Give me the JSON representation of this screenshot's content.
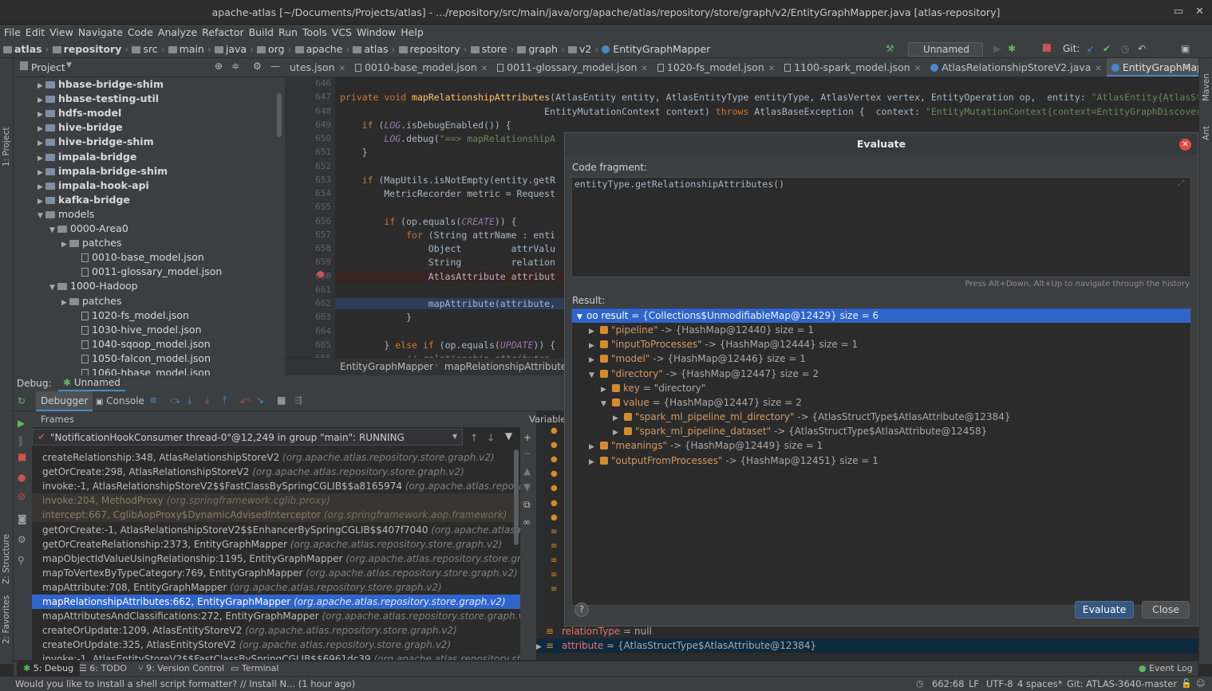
{
  "window": {
    "title": "apache-atlas [~/Documents/Projects/atlas] - .../repository/src/main/java/org/apache/atlas/repository/store/graph/v2/EntityGraphMapper.java [atlas-repository]"
  },
  "menu": [
    "File",
    "Edit",
    "View",
    "Navigate",
    "Code",
    "Analyze",
    "Refactor",
    "Build",
    "Run",
    "Tools",
    "VCS",
    "Window",
    "Help"
  ],
  "breadcrumbs": [
    "atlas",
    "repository",
    "src",
    "main",
    "java",
    "org",
    "apache",
    "atlas",
    "repository",
    "store",
    "graph",
    "v2",
    "EntityGraphMapper"
  ],
  "toolbar": {
    "run_config": "Unnamed",
    "git_label": "Git:"
  },
  "project_panel": {
    "title": "Project",
    "items": [
      {
        "label": "hbase-bridge-shim",
        "bold": true
      },
      {
        "label": "hbase-testing-util",
        "bold": true
      },
      {
        "label": "hdfs-model",
        "bold": true
      },
      {
        "label": "hive-bridge",
        "bold": true
      },
      {
        "label": "hive-bridge-shim",
        "bold": true
      },
      {
        "label": "impala-bridge",
        "bold": true
      },
      {
        "label": "impala-bridge-shim",
        "bold": true
      },
      {
        "label": "impala-hook-api",
        "bold": true
      },
      {
        "label": "kafka-bridge",
        "bold": true
      },
      {
        "label": "models",
        "bold": false
      },
      {
        "label": "0000-Area0",
        "bold": false
      },
      {
        "label": "patches",
        "bold": false
      },
      {
        "label": "0010-base_model.json",
        "bold": false
      },
      {
        "label": "0011-glossary_model.json",
        "bold": false
      },
      {
        "label": "1000-Hadoop",
        "bold": false
      },
      {
        "label": "patches",
        "bold": false
      },
      {
        "label": "1020-fs_model.json",
        "bold": false
      },
      {
        "label": "1030-hive_model.json",
        "bold": false
      },
      {
        "label": "1040-sqoop_model.json",
        "bold": false
      },
      {
        "label": "1050-falcon_model.json",
        "bold": false
      },
      {
        "label": "1060-hbase_model.json",
        "bold": false
      }
    ]
  },
  "editor_tabs": [
    "utes.json",
    "0010-base_model.json",
    "0011-glossary_model.json",
    "1020-fs_model.json",
    "1100-spark_model.json",
    "AtlasRelationshipStoreV2.java",
    "EntityGraphMapper.java"
  ],
  "editor": {
    "lines": [
      {
        "n": "646",
        "code": ""
      },
      {
        "n": "647",
        "code": "private void mapRelationshipAttributes(AtlasEntity entity, AtlasEntityType entityType, AtlasVertex vertex, EntityOperation op,  entity: \"AtlasEntity{AtlasStru"
      },
      {
        "n": "648",
        "code": "                                     EntityMutationContext context) throws AtlasBaseException {  context: \"EntityMutationContext{context=EntityGraphDiscoveryC"
      },
      {
        "n": "649",
        "code": "    if (LOG.isDebugEnabled()) {"
      },
      {
        "n": "650",
        "code": "        LOG.debug(\"==> mapRelationshipA"
      },
      {
        "n": "651",
        "code": "    }"
      },
      {
        "n": "652",
        "code": ""
      },
      {
        "n": "653",
        "code": "    if (MapUtils.isNotEmpty(entity.getR"
      },
      {
        "n": "654",
        "code": "        MetricRecorder metric = Request"
      },
      {
        "n": "655",
        "code": ""
      },
      {
        "n": "656",
        "code": "        if (op.equals(CREATE)) {"
      },
      {
        "n": "657",
        "code": "            for (String attrName : enti"
      },
      {
        "n": "658",
        "code": "                Object         attrValu"
      },
      {
        "n": "659",
        "code": "                String         relation"
      },
      {
        "n": "660",
        "code": "                AtlasAttribute attribut"
      },
      {
        "n": "661",
        "code": ""
      },
      {
        "n": "662",
        "code": "                mapAttribute(attribute,"
      },
      {
        "n": "663",
        "code": "            }"
      },
      {
        "n": "664",
        "code": ""
      },
      {
        "n": "665",
        "code": "        } else if (op.equals(UPDATE)) {"
      },
      {
        "n": "666",
        "code": "            // relationship attributes"
      }
    ],
    "breadcrumb": [
      "EntityGraphMapper",
      "mapRelationshipAttribute"
    ]
  },
  "debug": {
    "label": "Debug:",
    "session": "Unnamed",
    "tabs": [
      "Debugger",
      "Console"
    ],
    "frames_label": "Frames",
    "variables_label": "Variables",
    "thread": "\"NotificationHookConsumer thread-0\"@12,249 in group \"main\": RUNNING",
    "frames": [
      {
        "m": "createRelationship:348, AtlasRelationshipStoreV2",
        "p": "(org.apache.atlas.repository.store.graph.v2)",
        "t": "normal"
      },
      {
        "m": "getOrCreate:298, AtlasRelationshipStoreV2",
        "p": "(org.apache.atlas.repository.store.graph.v2)",
        "t": "normal"
      },
      {
        "m": "invoke:-1, AtlasRelationshipStoreV2$$FastClassBySpringCGLIB$$a8165974",
        "p": "(org.apache.atlas.repository.stor",
        "t": "normal"
      },
      {
        "m": "invoke:204, MethodProxy",
        "p": "(org.springframework.cglib.proxy)",
        "t": "lib"
      },
      {
        "m": "intercept:667, CglibAopProxy$DynamicAdvisedInterceptor",
        "p": "(org.springframework.aop.framework)",
        "t": "lib"
      },
      {
        "m": "getOrCreate:-1, AtlasRelationshipStoreV2$$EnhancerBySpringCGLIB$$407f7040",
        "p": "(org.apache.atlas.repositor",
        "t": "normal"
      },
      {
        "m": "getOrCreateRelationship:2373, EntityGraphMapper",
        "p": "(org.apache.atlas.repository.store.graph.v2)",
        "t": "normal"
      },
      {
        "m": "mapObjectIdValueUsingRelationship:1195, EntityGraphMapper",
        "p": "(org.apache.atlas.repository.store.graph.v2)",
        "t": "normal"
      },
      {
        "m": "mapToVertexByTypeCategory:769, EntityGraphMapper",
        "p": "(org.apache.atlas.repository.store.graph.v2)",
        "t": "normal"
      },
      {
        "m": "mapAttribute:708, EntityGraphMapper",
        "p": "(org.apache.atlas.repository.store.graph.v2)",
        "t": "normal"
      },
      {
        "m": "mapRelationshipAttributes:662, EntityGraphMapper",
        "p": "(org.apache.atlas.repository.store.graph.v2)",
        "t": "sel"
      },
      {
        "m": "mapAttributesAndClassifications:272, EntityGraphMapper",
        "p": "(org.apache.atlas.repository.store.graph.v2)",
        "t": "normal"
      },
      {
        "m": "createOrUpdate:1209, AtlasEntityStoreV2",
        "p": "(org.apache.atlas.repository.store.graph.v2)",
        "t": "normal"
      },
      {
        "m": "createOrUpdate:325, AtlasEntityStoreV2",
        "p": "(org.apache.atlas.repository.store.graph.v2)",
        "t": "normal"
      },
      {
        "m": "invoke:-1, AtlasEntityStoreV2$$FastClassBySpringCGLIB$$6961dc39",
        "p": "(org.apache.atlas.repository.store.gra",
        "t": "normal"
      }
    ],
    "vars_bottom": [
      {
        "name": "relationType",
        "val": " = null"
      },
      {
        "name": "attribute",
        "val": " = {AtlasStructType$AtlasAttribute@12384}"
      }
    ]
  },
  "evaluate_dialog": {
    "title": "Evaluate",
    "code_label": "Code fragment:",
    "expression": "entityType.getRelationshipAttributes()",
    "history_hint": "Press Alt+Down, Alt+Up to navigate through the history",
    "result_label": "Result:",
    "result_rows": [
      {
        "indent": 0,
        "arrow": "▼",
        "key": "oo result",
        "rest": " = {Collections$UnmodifiableMap@12429}  size = 6",
        "sel": true
      },
      {
        "indent": 1,
        "arrow": "▶",
        "key": "\"pipeline\"",
        "rest": " -> {HashMap@12440}  size = 1",
        "sel": false
      },
      {
        "indent": 1,
        "arrow": "▶",
        "key": "\"inputToProcesses\"",
        "rest": " -> {HashMap@12444}  size = 1",
        "sel": false
      },
      {
        "indent": 1,
        "arrow": "▶",
        "key": "\"model\"",
        "rest": " -> {HashMap@12446}  size = 1",
        "sel": false
      },
      {
        "indent": 1,
        "arrow": "▼",
        "key": "\"directory\"",
        "rest": " -> {HashMap@12447}  size = 2",
        "sel": false
      },
      {
        "indent": 2,
        "arrow": "▶",
        "key": "key",
        "rest": " = \"directory\"",
        "sel": false
      },
      {
        "indent": 2,
        "arrow": "▼",
        "key": "value",
        "rest": " = {HashMap@12447}  size = 2",
        "sel": false
      },
      {
        "indent": 3,
        "arrow": "▶",
        "key": "\"spark_ml_pipeline_ml_directory\"",
        "rest": " -> {AtlasStructType$AtlasAttribute@12384}",
        "sel": false
      },
      {
        "indent": 3,
        "arrow": "▶",
        "key": "\"spark_ml_pipeline_dataset\"",
        "rest": " -> {AtlasStructType$AtlasAttribute@12458}",
        "sel": false
      },
      {
        "indent": 1,
        "arrow": "▶",
        "key": "\"meanings\"",
        "rest": " -> {HashMap@12449}  size = 1",
        "sel": false
      },
      {
        "indent": 1,
        "arrow": "▶",
        "key": "\"outputFromProcesses\"",
        "rest": " -> {HashMap@12451}  size = 1",
        "sel": false
      }
    ],
    "evaluate_button": "Evaluate",
    "close_button": "Close",
    "help": "?"
  },
  "bottom_tabs": [
    "5: Debug",
    "6: TODO",
    "9: Version Control",
    "Terminal"
  ],
  "event_log": "Event Log",
  "side_labels": {
    "project": "1: Project",
    "structure": "Z: Structure",
    "favorites": "2: Favorites",
    "maven": "Maven",
    "ant": "Ant"
  },
  "status": {
    "message": "Would you like to install a shell script formatter? // Install   N... (1 hour ago)",
    "position": "662:68",
    "line_sep": "LF",
    "encoding": "UTF-8",
    "indent": "4 spaces*",
    "git": "Git: ATLAS-3640-master"
  },
  "colors": {
    "accent": "#2f65ca",
    "editor_bg": "#2b2b2b",
    "panel_bg": "#3c3f41",
    "keyword": "#cc7832",
    "string": "#6a8759"
  }
}
